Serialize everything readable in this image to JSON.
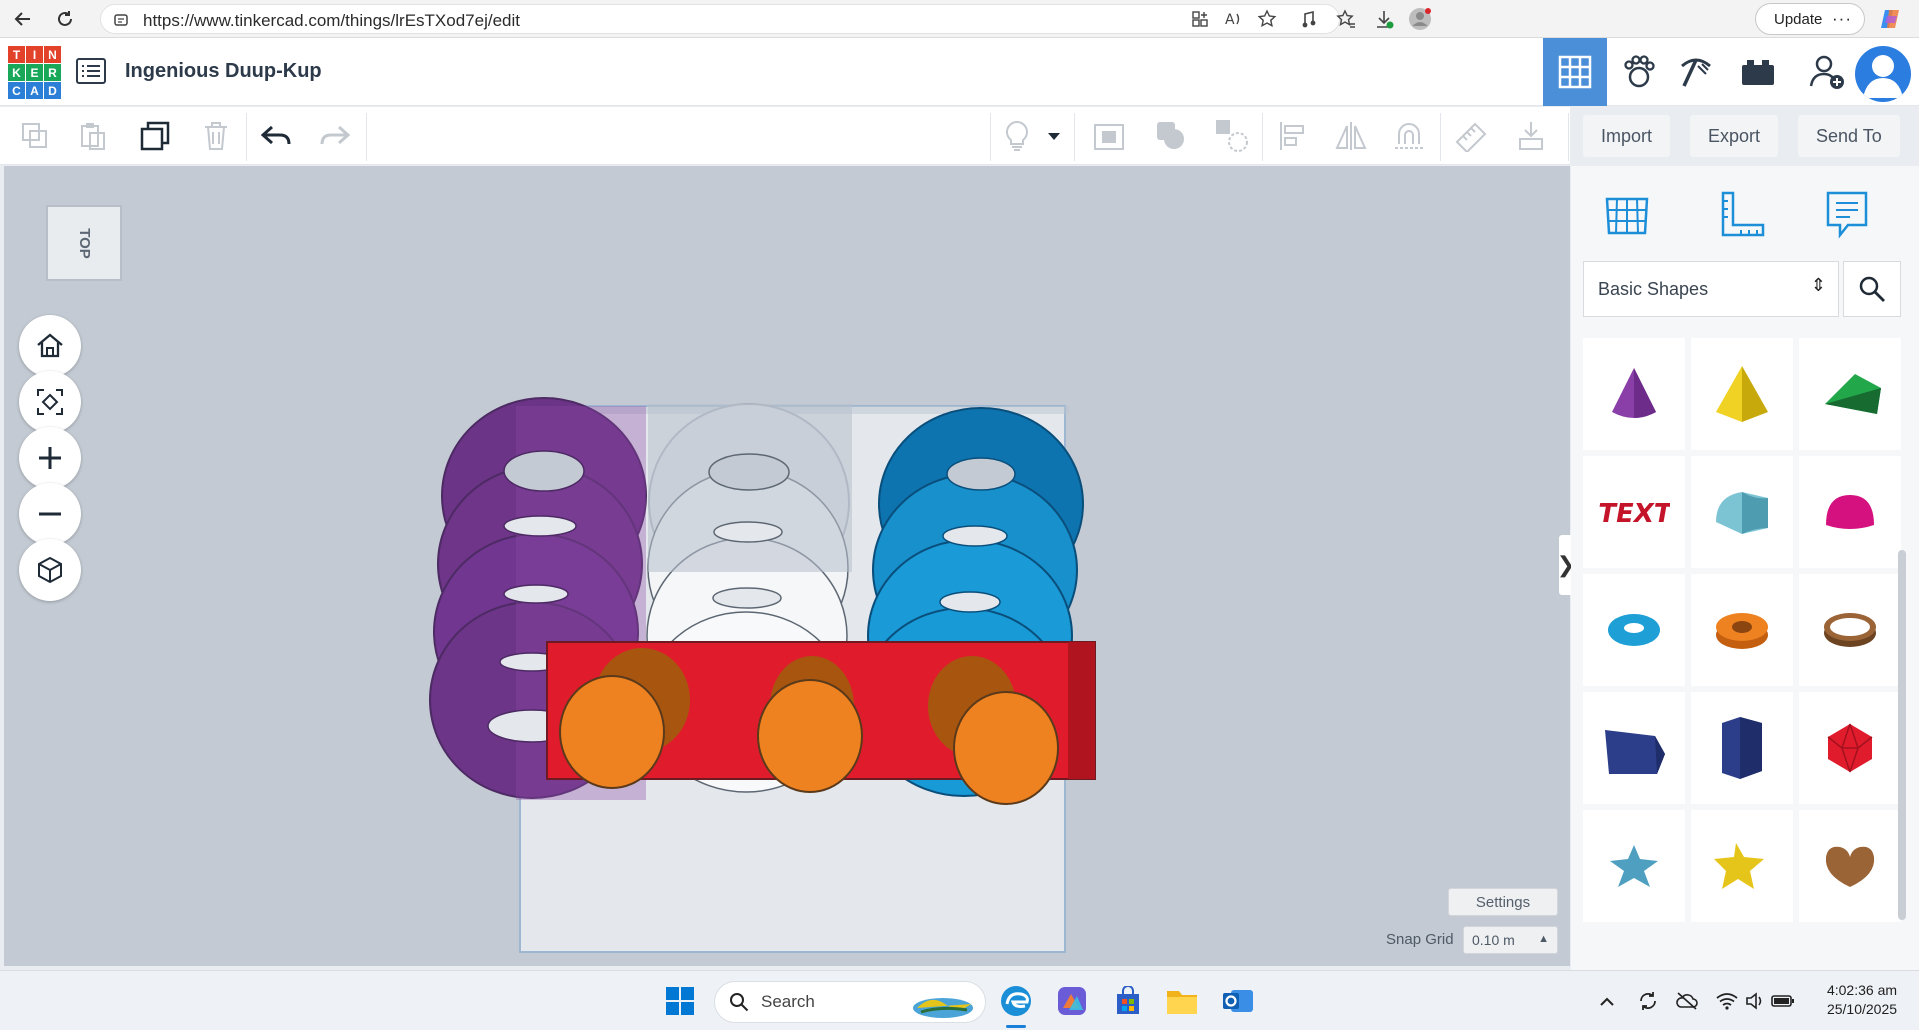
{
  "browser": {
    "url": "https://www.tinkercad.com/things/lrEsTXod7ej/edit",
    "update_label": "Update",
    "more_label": "···"
  },
  "app": {
    "logo_letters": [
      "T",
      "I",
      "N",
      "K",
      "E",
      "R",
      "C",
      "A",
      "D"
    ],
    "logo_colors": [
      "#e2412a",
      "#e2412a",
      "#e2412a",
      "#19a85a",
      "#19a85a",
      "#19a85a",
      "#2b7fd6",
      "#2b7fd6",
      "#2b7fd6"
    ],
    "title": "Ingenious Duup-Kup",
    "accent": "#4a8fd8"
  },
  "toolbar": {
    "import_label": "Import",
    "export_label": "Export",
    "sendto_label": "Send To"
  },
  "canvas": {
    "viewcube_label": "TOP",
    "settings_label": "Settings",
    "snap_grid_label": "Snap Grid",
    "snap_grid_value": "0.10 m",
    "colors": {
      "workplane": "#c3cad3",
      "purple": "#7b3d97",
      "white": "#f2f4f6",
      "blue": "#1e9fd6",
      "red": "#e01c2c",
      "orange": "#ee8120"
    }
  },
  "panel": {
    "shape_category": "Basic Shapes",
    "shapes": [
      {
        "name": "cone-shape",
        "icon": "cone"
      },
      {
        "name": "pyramid-shape",
        "icon": "pyramid"
      },
      {
        "name": "roof-shape",
        "icon": "roof"
      },
      {
        "name": "text-shape",
        "icon": "text"
      },
      {
        "name": "half-cylinder-shape",
        "icon": "round-roof"
      },
      {
        "name": "half-sphere-shape",
        "icon": "half-sphere"
      },
      {
        "name": "torus-shape",
        "icon": "torus"
      },
      {
        "name": "tube-shape",
        "icon": "tube"
      },
      {
        "name": "ring-shape",
        "icon": "ring"
      },
      {
        "name": "wedge-shape",
        "icon": "wedge"
      },
      {
        "name": "polygon-shape",
        "icon": "polygon"
      },
      {
        "name": "icosahedron-shape",
        "icon": "icosahedron"
      },
      {
        "name": "star-shape",
        "icon": "star"
      },
      {
        "name": "star-yellow-shape",
        "icon": "star-yellow"
      },
      {
        "name": "heart-shape",
        "icon": "heart"
      }
    ]
  },
  "taskbar": {
    "search_label": "Search",
    "time": "4:02:36 am",
    "date": "25/10/2025"
  }
}
